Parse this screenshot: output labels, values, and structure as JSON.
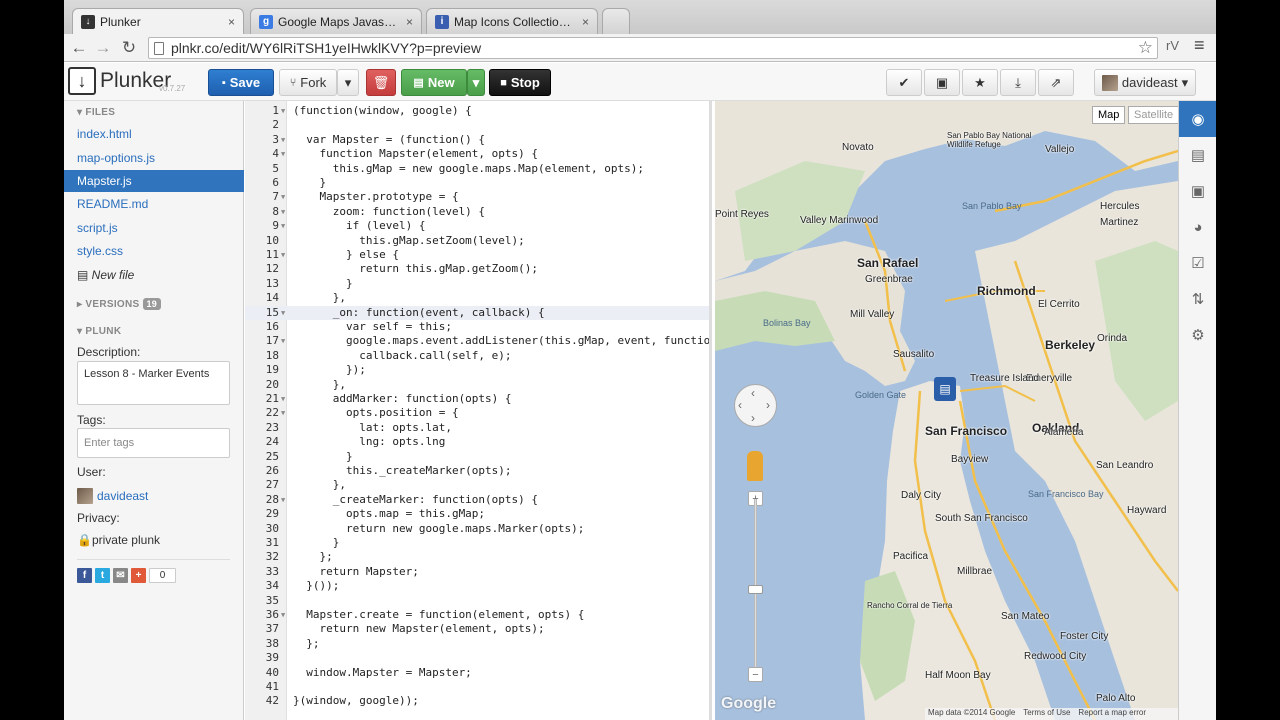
{
  "browser": {
    "tabs": [
      {
        "title": "Plunker",
        "favicon_color": "#333333",
        "favicon_glyph": "↓"
      },
      {
        "title": "Google Maps Javascript AP",
        "favicon_color": "#3b7be3",
        "favicon_glyph": "g"
      },
      {
        "title": "Map Icons Collection | Goo",
        "favicon_color": "#3b5fb0",
        "favicon_glyph": "i"
      }
    ],
    "close_glyph": "×",
    "url": "plnkr.co/edit/WY6lRiTSH1yeIHwklKVY?p=preview",
    "back_icon": "←",
    "forward_icon": "→",
    "reload_icon": "↻",
    "star_icon": "☆",
    "ext_label": "rV",
    "menu_icon": "≡"
  },
  "header": {
    "brand": "Plunker",
    "version": "v0.7.27",
    "save_label": "Save",
    "fork_label": "Fork",
    "new_label": "New",
    "stop_label": "Stop",
    "user_name": "davideast",
    "caret": "▾"
  },
  "sidebar": {
    "files_heading": "FILES",
    "files": [
      "index.html",
      "map-options.js",
      "Mapster.js",
      "README.md",
      "script.js",
      "style.css"
    ],
    "active_file": "Mapster.js",
    "new_file_label": "New file",
    "versions_heading": "VERSIONS",
    "versions_count": "19",
    "plunk_heading": "PLUNK",
    "description_label": "Description:",
    "description_value": "Lesson 8 - Marker Events",
    "tags_label": "Tags:",
    "tags_placeholder": "Enter tags",
    "user_label": "User:",
    "user_value": "davideast",
    "privacy_label": "Privacy:",
    "privacy_value": "private plunk",
    "share_count": "0"
  },
  "editor": {
    "highlighted_line": 15,
    "lines": [
      "(function(window, google) {",
      "",
      "  var Mapster = (function() {",
      "    function Mapster(element, opts) {",
      "      this.gMap = new google.maps.Map(element, opts);",
      "    }",
      "    Mapster.prototype = {",
      "      zoom: function(level) {",
      "        if (level) {",
      "          this.gMap.setZoom(level);",
      "        } else {",
      "          return this.gMap.getZoom();",
      "        }",
      "      },",
      "      _on: function(event, callback) {",
      "        var self = this;",
      "        google.maps.event.addListener(this.gMap, event, function(e",
      "          callback.call(self, e);",
      "        });",
      "      },",
      "      addMarker: function(opts) {",
      "        opts.position = {",
      "          lat: opts.lat,",
      "          lng: opts.lng",
      "        }",
      "        this._createMarker(opts);",
      "      },",
      "      _createMarker: function(opts) {",
      "        opts.map = this.gMap;",
      "        return new google.maps.Marker(opts);",
      "      }",
      "    };",
      "    return Mapster;",
      "  }());",
      "",
      "  Mapster.create = function(element, opts) {",
      "    return new Mapster(element, opts);",
      "  };",
      "",
      "  window.Mapster = Mapster;",
      "",
      "}(window, google));"
    ],
    "folded_lines": [
      1,
      3,
      4,
      7,
      8,
      9,
      11,
      15,
      17,
      21,
      22,
      28,
      36
    ]
  },
  "map": {
    "map_type_label": "Map",
    "satellite_label": "Satellite",
    "google_label": "Google",
    "attribution": "Map data ©2014 Google",
    "terms": "Terms of Use",
    "report": "Report a map error",
    "zoom_in": "+",
    "zoom_out": "−",
    "labels": [
      {
        "text": "San Rafael",
        "cls": "big"
      },
      {
        "text": "Richmond",
        "cls": "big"
      },
      {
        "text": "Berkeley",
        "cls": "big"
      },
      {
        "text": "Oakland",
        "cls": "big"
      },
      {
        "text": "San Francisco",
        "cls": "big"
      },
      {
        "text": "Daly City",
        "cls": ""
      },
      {
        "text": "Novato",
        "cls": ""
      },
      {
        "text": "Vallejo",
        "cls": ""
      },
      {
        "text": "Mill Valley",
        "cls": ""
      },
      {
        "text": "Sausalito",
        "cls": ""
      },
      {
        "text": "Alameda",
        "cls": ""
      },
      {
        "text": "San Leandro",
        "cls": ""
      },
      {
        "text": "Pacifica",
        "cls": ""
      },
      {
        "text": "Millbrae",
        "cls": ""
      },
      {
        "text": "Redwood City",
        "cls": ""
      },
      {
        "text": "San Pablo Bay",
        "cls": "water"
      },
      {
        "text": "San Francisco Bay",
        "cls": "water"
      },
      {
        "text": "Golden Gate",
        "cls": "water"
      },
      {
        "text": "Bolinas Bay",
        "cls": "water"
      },
      {
        "text": "El Cerrito",
        "cls": ""
      },
      {
        "text": "Emeryville",
        "cls": ""
      },
      {
        "text": "Orinda",
        "cls": ""
      },
      {
        "text": "Martinez",
        "cls": ""
      },
      {
        "text": "Hercules",
        "cls": ""
      },
      {
        "text": "Valley Marinwood",
        "cls": ""
      },
      {
        "text": "Greenbrae",
        "cls": ""
      },
      {
        "text": "San Mateo",
        "cls": ""
      },
      {
        "text": "Half Moon Bay",
        "cls": ""
      },
      {
        "text": "Palo Alto",
        "cls": ""
      },
      {
        "text": "Foster City",
        "cls": ""
      },
      {
        "text": "Treasure Island",
        "cls": ""
      },
      {
        "text": "Bayview",
        "cls": ""
      },
      {
        "text": "South San Francisco",
        "cls": ""
      },
      {
        "text": "Rancho Corral de Tierra",
        "cls": ""
      },
      {
        "text": "San Pablo Bay National Wildlife Refuge",
        "cls": ""
      },
      {
        "text": "Point Reyes",
        "cls": ""
      },
      {
        "text": "Hayward",
        "cls": ""
      }
    ]
  },
  "rail": {
    "icons": [
      "eye-icon",
      "book-icon",
      "briefcase-icon",
      "palette-icon",
      "checkbox-icon",
      "sync-icon",
      "gear-icon"
    ],
    "glyphs": [
      "◉",
      "▤",
      "▣",
      "◕",
      "☑",
      "⇅",
      "⚙"
    ]
  },
  "colors": {
    "brand_blue": "#2f74bd",
    "save": "#2f7fd1",
    "delete": "#d04c4c",
    "new": "#5aac5a",
    "stop": "#222222"
  }
}
